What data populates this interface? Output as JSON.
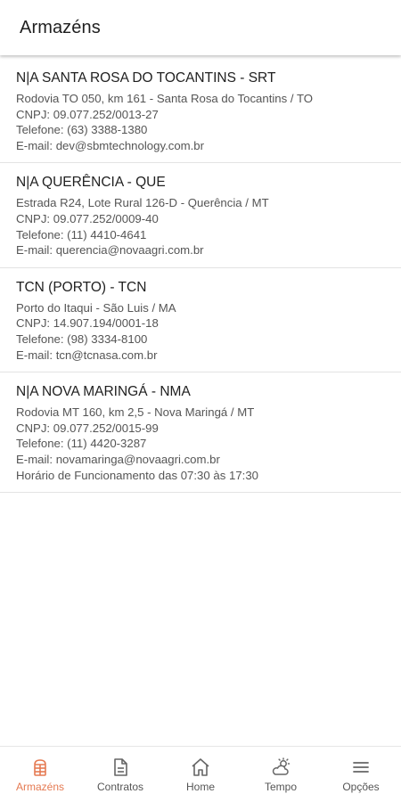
{
  "header": {
    "title": "Armazéns"
  },
  "warehouses": [
    {
      "name": "N|A SANTA ROSA DO TOCANTINS - SRT",
      "address": "Rodovia TO 050, km 161 - Santa Rosa do Tocantins / TO",
      "cnpj": "CNPJ: 09.077.252/0013-27",
      "phone": "Telefone: (63) 3388-1380",
      "email": "E-mail: dev@sbmtechnology.com.br"
    },
    {
      "name": "N|A QUERÊNCIA - QUE",
      "address": "Estrada R24, Lote Rural 126-D - Querência / MT",
      "cnpj": "CNPJ: 09.077.252/0009-40",
      "phone": "Telefone: (11) 4410-4641",
      "email": "E-mail: querencia@novaagri.com.br"
    },
    {
      "name": "TCN (PORTO) - TCN",
      "address": "Porto do Itaqui - São Luis / MA",
      "cnpj": "CNPJ: 14.907.194/0001-18",
      "phone": "Telefone: (98) 3334-8100",
      "email": "E-mail: tcn@tcnasa.com.br"
    },
    {
      "name": "N|A NOVA MARINGÁ - NMA",
      "address": "Rodovia MT 160, km 2,5 - Nova Maringá / MT",
      "cnpj": "CNPJ: 09.077.252/0015-99",
      "phone": "Telefone: (11) 4420-3287",
      "email": "E-mail: novamaringa@novaagri.com.br",
      "hours": "Horário de Funcionamento das 07:30 às 17:30"
    }
  ],
  "bottom_nav": {
    "armazens": {
      "label": "Armazéns",
      "icon": "silo-icon",
      "active": true
    },
    "contratos": {
      "label": "Contratos",
      "icon": "document-icon"
    },
    "home": {
      "label": "Home",
      "icon": "home-icon"
    },
    "tempo": {
      "label": "Tempo",
      "icon": "weather-icon"
    },
    "opcoes": {
      "label": "Opções",
      "icon": "menu-icon"
    }
  },
  "colors": {
    "accent": "#e57a52",
    "icon": "#666666"
  }
}
